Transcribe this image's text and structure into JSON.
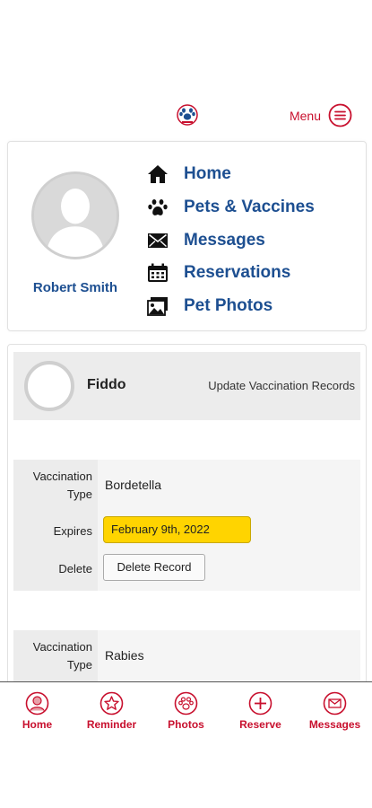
{
  "header": {
    "menu_label": "Menu"
  },
  "profile": {
    "user_name": "Robert Smith",
    "nav": [
      {
        "label": "Home",
        "icon": "home-icon"
      },
      {
        "label": "Pets & Vaccines",
        "icon": "paw-icon"
      },
      {
        "label": "Messages",
        "icon": "envelope-icon"
      },
      {
        "label": "Reservations",
        "icon": "calendar-icon"
      },
      {
        "label": "Pet Photos",
        "icon": "photos-icon"
      }
    ]
  },
  "pet": {
    "name": "Fiddo",
    "update_link": "Update Vaccination Records",
    "records": [
      {
        "type_label": "Vaccination Type",
        "type_value": "Bordetella",
        "expires_label": "Expires",
        "expires_value": "February 9th, 2022",
        "delete_label": "Delete",
        "delete_button": "Delete Record"
      },
      {
        "type_label": "Vaccination Type",
        "type_value": "Rabies"
      }
    ]
  },
  "bottom_nav": [
    {
      "label": "Home",
      "icon": "user-circle-icon"
    },
    {
      "label": "Reminder",
      "icon": "star-icon"
    },
    {
      "label": "Photos",
      "icon": "paw-circle-icon"
    },
    {
      "label": "Reserve",
      "icon": "plus-circle-icon"
    },
    {
      "label": "Messages",
      "icon": "envelope-circle-icon"
    }
  ],
  "colors": {
    "accent_red": "#c8102e",
    "link_blue": "#1d4f91",
    "expires_highlight": "#ffd400"
  }
}
